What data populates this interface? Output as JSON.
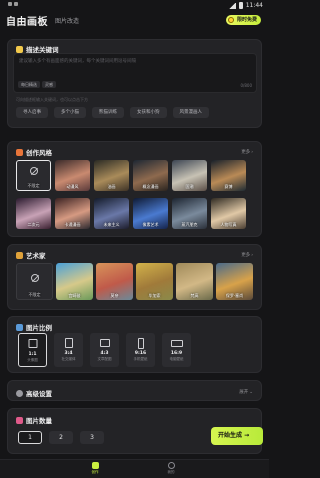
{
  "status": {
    "time": "11:44"
  },
  "header": {
    "logo": "自由画板",
    "subtitle": "图片改造",
    "vip_label": "限时免费"
  },
  "prompt": {
    "title": "描述关键词",
    "placeholder": "建议输入多个有画面感的关键词，每个关键词间用逗号间隔",
    "btn1": "每日精选",
    "btn2": "灵感",
    "count": "0/800",
    "hint": "可向描述框输入关键词，也可以点击下方",
    "chips": [
      "寻人启事",
      "多个小猫",
      "熊猫训练",
      "女孩和小狗",
      "风景漫画人"
    ]
  },
  "style": {
    "title": "创作风格",
    "more": "更多",
    "row1": [
      "不限定",
      "动漫风",
      "油画",
      "概念漫画",
      "国潮",
      "赛博"
    ],
    "row2": [
      "二次元",
      "卡通漫画",
      "未来主义",
      "像素艺术",
      "蒸汽朋克",
      "人物写真"
    ]
  },
  "artist": {
    "title": "艺术家",
    "more": "更多",
    "items": [
      "不限定",
      "宫崎骏",
      "莫奈",
      "毕加索",
      "梵高",
      "保罗·塞尚"
    ]
  },
  "ratio": {
    "title": "图片比例",
    "items": [
      {
        "value": "1:1",
        "sub": "头像图"
      },
      {
        "value": "3:4",
        "sub": "社交媒体"
      },
      {
        "value": "4:3",
        "sub": "文章配图"
      },
      {
        "value": "9:16",
        "sub": "手机壁纸"
      },
      {
        "value": "16:9",
        "sub": "电脑壁纸"
      }
    ]
  },
  "advanced": {
    "title": "高级设置",
    "toggle": "展开"
  },
  "quantity": {
    "title": "图片数量",
    "options": [
      "1",
      "2",
      "3"
    ]
  },
  "generate": {
    "label": "开始生成 →"
  },
  "nav": {
    "create": "创作",
    "explore": "我的"
  },
  "colors": {
    "accent": "#c9ef40",
    "bg": "#151517",
    "card": "#232326"
  }
}
